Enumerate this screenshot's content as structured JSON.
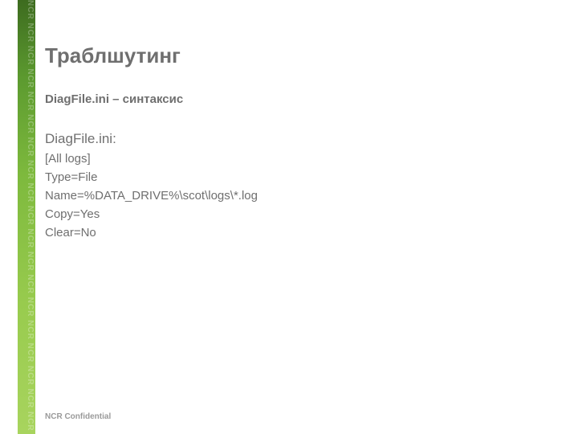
{
  "band_text": "NCR NCR NCR NCR NCR NCR NCR NCR NCR NCR NCR NCR NCR NCR NCR NCR NCR NCR NCR NCR NCR NCR NCR NCR",
  "title": "Траблшутинг",
  "subtitle": "DiagFile.ini – синтаксис",
  "file_label": "DiagFile.ini:",
  "ini_lines": {
    "l0": "[All logs]",
    "l1": "Type=File",
    "l2": "Name=%DATA_DRIVE%\\scot\\logs\\*.log",
    "l3": "Copy=Yes",
    "l4": "Clear=No"
  },
  "footer": "NCR Confidential"
}
